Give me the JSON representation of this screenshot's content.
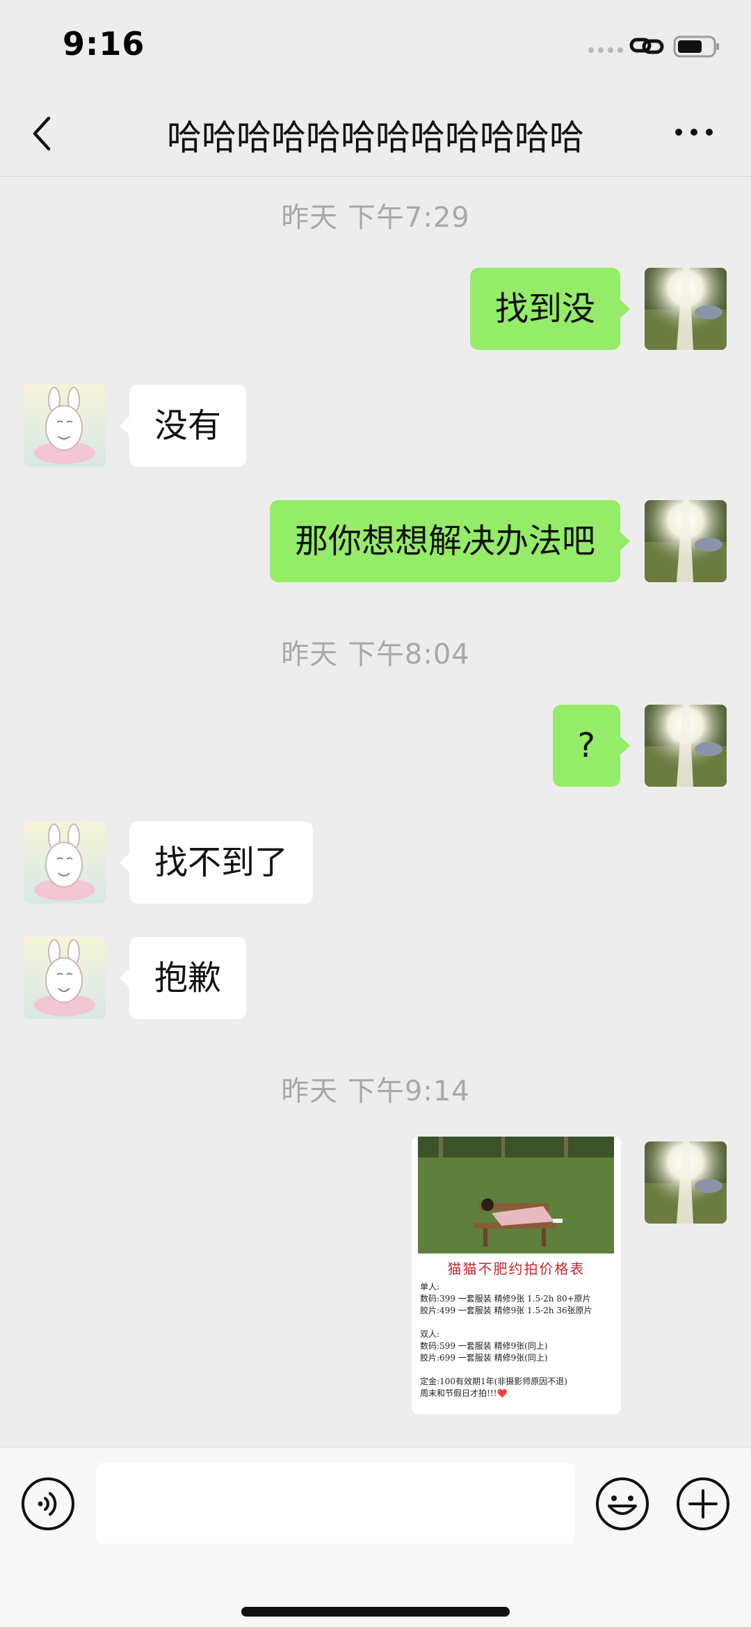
{
  "status_bar": {
    "time": "9:16"
  },
  "header": {
    "title": "哈哈哈哈哈哈哈哈哈哈哈哈"
  },
  "messages": {
    "ts1": "昨天 下午7:29",
    "m1": "找到没",
    "m2": "没有",
    "m3": "那你想想解决办法吧",
    "ts2": "昨天 下午8:04",
    "m4": "?",
    "m5": "找不到了",
    "m6": "抱歉",
    "ts3": "昨天 下午9:14"
  },
  "image_message": {
    "title": "猫猫不肥约拍价格表",
    "lines": [
      "单人:",
      "数码:399 一套服装 精修9张 1.5-2h 80+原片",
      "胶片:499 一套服装 精修9张 1.5-2h 36张原片",
      "双人:",
      "数码:599 一套服装 精修9张(同上)",
      "胶片:699 一套服装 精修9张(同上)",
      "定金:100有效期1年(非摄影师原因不退)",
      "周末和节假日才拍!!!❤️"
    ]
  },
  "input_bar": {
    "placeholder": ""
  },
  "colors": {
    "outgoing_bubble": "#95ec69",
    "incoming_bubble": "#ffffff",
    "background": "#ededed",
    "poster_title": "#c8262c"
  },
  "icons": {
    "back": "chevron-left-icon",
    "more": "more-dots-icon",
    "voice": "voice-icon",
    "emoji": "emoji-icon",
    "plus": "plus-icon"
  }
}
